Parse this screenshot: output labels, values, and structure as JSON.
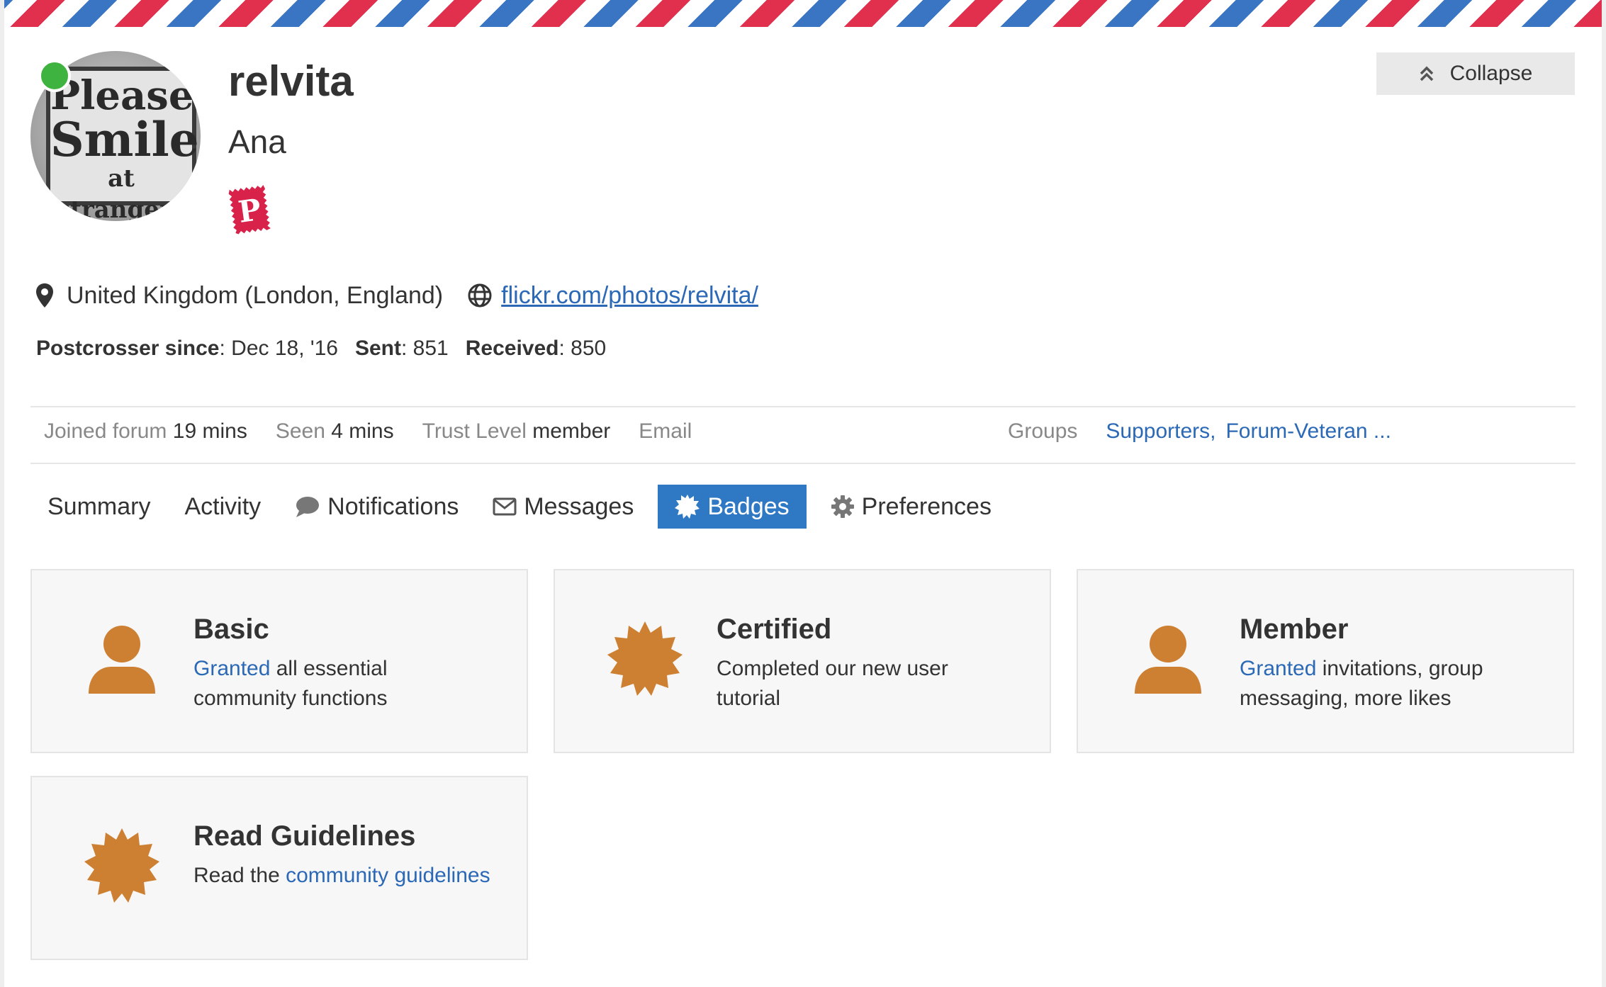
{
  "profile": {
    "username": "relvita",
    "full_name": "Ana",
    "avatar_text": [
      "Please",
      "Smile",
      "at strangers"
    ],
    "status_color": "#3fb33f",
    "stamp_letter": "P",
    "location": "United Kingdom (London, England)",
    "website": "flickr.com/photos/relvita/"
  },
  "stats": {
    "since_label": "Postcrosser since",
    "since_value": ": Dec 18, '16",
    "sent_label": "Sent",
    "sent_value": ": 851",
    "received_label": "Received",
    "received_value": ": 850"
  },
  "collapse_label": "Collapse",
  "meta": {
    "joined_label": "Joined forum",
    "joined_value": "19 mins",
    "seen_label": "Seen",
    "seen_value": "4 mins",
    "trust_label": "Trust Level",
    "trust_value": "member",
    "email_label": "Email",
    "groups_label": "Groups",
    "groups": [
      "Supporters,",
      "Forum-Veteran ..."
    ]
  },
  "nav": [
    {
      "label": "Summary",
      "icon": ""
    },
    {
      "label": "Activity",
      "icon": ""
    },
    {
      "label": "Notifications",
      "icon": "comment-icon"
    },
    {
      "label": "Messages",
      "icon": "envelope-icon"
    },
    {
      "label": "Badges",
      "icon": "certificate-icon",
      "active": true
    },
    {
      "label": "Preferences",
      "icon": "gear-icon"
    }
  ],
  "badges": [
    {
      "title": "Basic",
      "icon": "user-icon",
      "link": "Granted",
      "rest": " all essential community functions"
    },
    {
      "title": "Certified",
      "icon": "certificate-icon",
      "text": "Completed our new user tutorial"
    },
    {
      "title": "Member",
      "icon": "user-icon",
      "link": "Granted",
      "rest": " invitations, group messaging, more likes"
    },
    {
      "title": "Read Guidelines",
      "icon": "certificate-icon",
      "pre": "Read the ",
      "link": "community guidelines"
    }
  ],
  "colors": {
    "accent": "#2f79c4",
    "badge_bronze": "#cd7f32",
    "link": "#2b68b5"
  }
}
